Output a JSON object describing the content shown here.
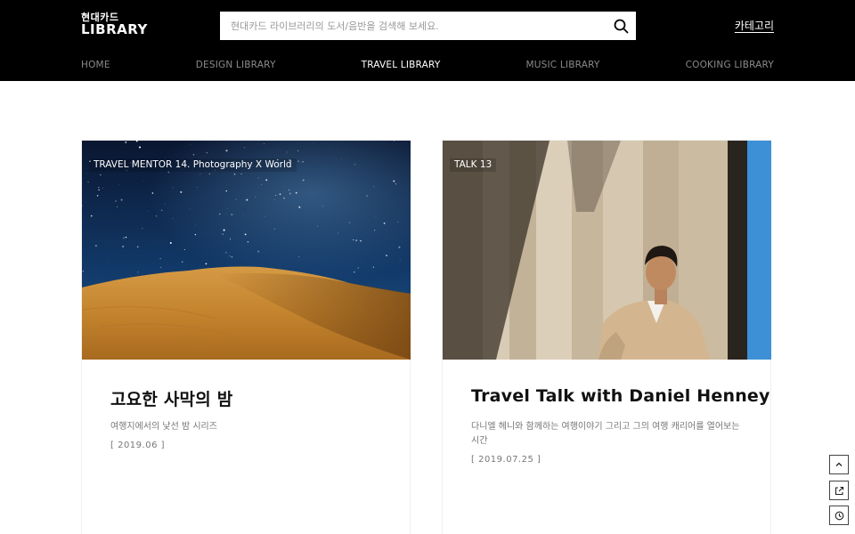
{
  "header": {
    "logo_top": "현대카드",
    "logo_main": "LIBRARY",
    "search_placeholder": "현대카드 라이브러리의 도서/음반을 검색해 보세요.",
    "category_label": "카테고리"
  },
  "nav": {
    "items": [
      {
        "label": "HOME",
        "active": false
      },
      {
        "label": "DESIGN LIBRARY",
        "active": false
      },
      {
        "label": "TRAVEL LIBRARY",
        "active": true
      },
      {
        "label": "MUSIC LIBRARY",
        "active": false
      },
      {
        "label": "COOKING LIBRARY",
        "active": false
      }
    ]
  },
  "cards": [
    {
      "badge": "TRAVEL MENTOR 14. Photography X World",
      "title": "고요한 사막의 밤",
      "description": "여행지에서의 낯선 밤 시리즈",
      "date": "[ 2019.06 ]"
    },
    {
      "badge": "TALK 13",
      "title": "Travel Talk with Daniel Henney",
      "description": "다니엘 헤니와 함께하는 여행이야기 그리고 그의 여행 캐리어를 열어보는 시간",
      "date": "[ 2019.07.25 ]"
    }
  ],
  "icons": {
    "search": "search-icon",
    "scroll_top": "chevron-up-icon",
    "share": "external-link-icon",
    "recent": "clock-icon"
  },
  "colors": {
    "header_bg": "#000000",
    "nav_inactive": "#8a8a8a",
    "nav_active": "#ffffff"
  }
}
